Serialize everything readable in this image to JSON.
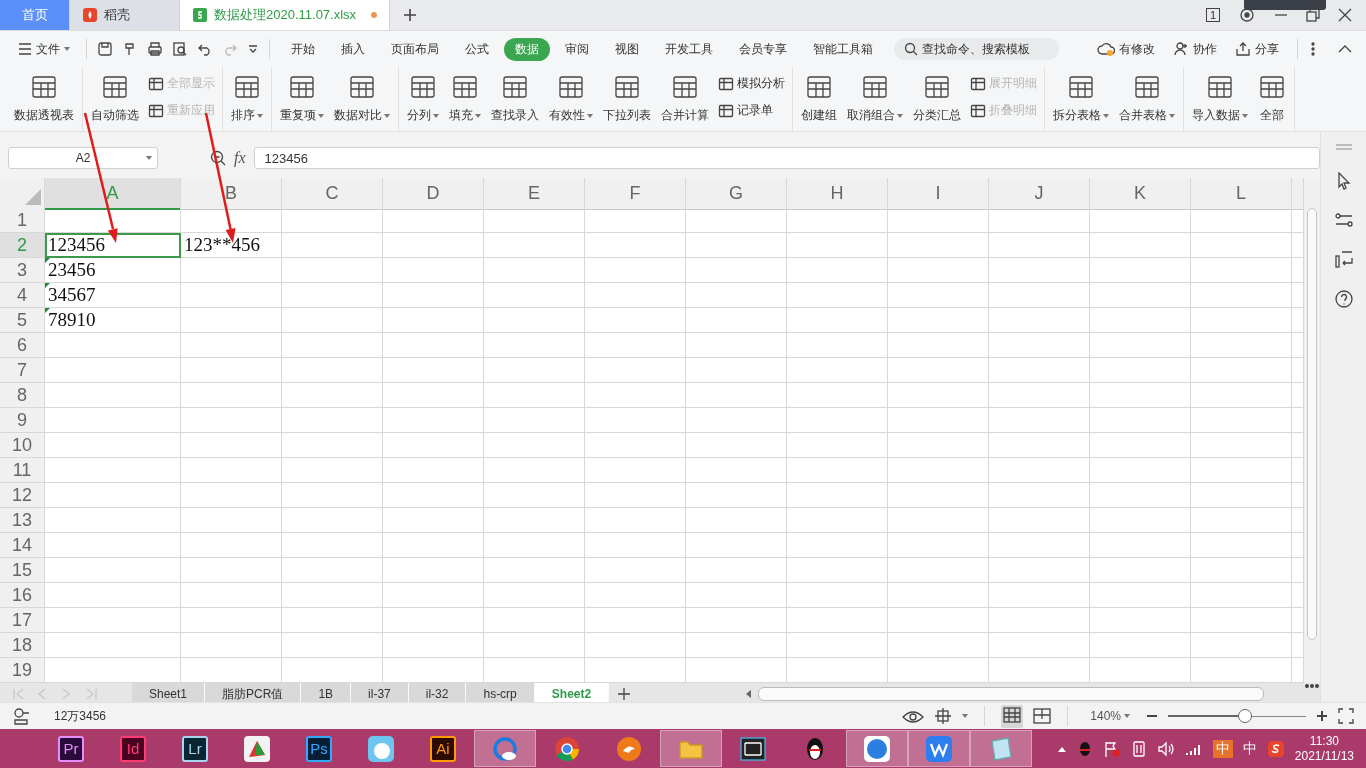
{
  "doc_tabs": [
    {
      "label": "首页",
      "kind": "home",
      "selected": false,
      "unsaved": false
    },
    {
      "label": "稻壳",
      "kind": "docer",
      "selected": false,
      "unsaved": false
    },
    {
      "label": "数据处理2020.11.07.xlsx",
      "kind": "sheet",
      "selected": true,
      "unsaved": true
    }
  ],
  "window_badge": "1",
  "menu": {
    "file": "文件",
    "tabs": [
      {
        "label": "开始",
        "selected": false
      },
      {
        "label": "插入",
        "selected": false
      },
      {
        "label": "页面布局",
        "selected": false
      },
      {
        "label": "公式",
        "selected": false
      },
      {
        "label": "数据",
        "selected": true
      },
      {
        "label": "审阅",
        "selected": false
      },
      {
        "label": "视图",
        "selected": false
      },
      {
        "label": "开发工具",
        "selected": false
      },
      {
        "label": "会员专享",
        "selected": false
      },
      {
        "label": "智能工具箱",
        "selected": false
      }
    ],
    "search": {
      "placeholder": "查找命令、搜索模板"
    },
    "actions": [
      {
        "label": "有修改",
        "kind": "cloud"
      },
      {
        "label": "协作",
        "kind": "user"
      },
      {
        "label": "分享",
        "kind": "share"
      }
    ]
  },
  "ribbon": {
    "groups": [
      {
        "items": [
          {
            "label": "数据透视表",
            "kind": "large",
            "dropdown": false,
            "disabled": false
          }
        ]
      },
      {
        "items": [
          {
            "label": "自动筛选",
            "kind": "large",
            "dropdown": false,
            "disabled": false
          },
          {
            "label": "全部显示",
            "kind": "small",
            "dropdown": false,
            "disabled": true
          },
          {
            "label": "重新应用",
            "kind": "small",
            "dropdown": false,
            "disabled": true
          }
        ]
      },
      {
        "items": [
          {
            "label": "排序",
            "kind": "large",
            "dropdown": true,
            "disabled": false
          }
        ]
      },
      {
        "items": [
          {
            "label": "重复项",
            "kind": "large",
            "dropdown": true,
            "disabled": false
          },
          {
            "label": "数据对比",
            "kind": "large",
            "dropdown": true,
            "disabled": false
          }
        ]
      },
      {
        "items": [
          {
            "label": "分列",
            "kind": "large",
            "dropdown": true,
            "disabled": false
          },
          {
            "label": "填充",
            "kind": "large",
            "dropdown": true,
            "disabled": false
          },
          {
            "label": "查找录入",
            "kind": "large",
            "dropdown": false,
            "disabled": false
          },
          {
            "label": "有效性",
            "kind": "large",
            "dropdown": true,
            "disabled": false
          },
          {
            "label": "下拉列表",
            "kind": "large",
            "dropdown": false,
            "disabled": false
          },
          {
            "label": "合并计算",
            "kind": "large",
            "dropdown": false,
            "disabled": false
          },
          {
            "label": "模拟分析",
            "kind": "small",
            "dropdown": false,
            "disabled": false
          },
          {
            "label": "记录单",
            "kind": "small",
            "dropdown": false,
            "disabled": false
          }
        ]
      },
      {
        "items": [
          {
            "label": "创建组",
            "kind": "large",
            "dropdown": false,
            "disabled": false
          },
          {
            "label": "取消组合",
            "kind": "large",
            "dropdown": true,
            "disabled": false
          },
          {
            "label": "分类汇总",
            "kind": "large",
            "dropdown": false,
            "disabled": false
          },
          {
            "label": "展开明细",
            "kind": "small",
            "dropdown": false,
            "disabled": true
          },
          {
            "label": "折叠明细",
            "kind": "small",
            "dropdown": false,
            "disabled": true
          }
        ]
      },
      {
        "items": [
          {
            "label": "拆分表格",
            "kind": "large",
            "dropdown": true,
            "disabled": false
          },
          {
            "label": "合并表格",
            "kind": "large",
            "dropdown": true,
            "disabled": false
          }
        ]
      },
      {
        "items": [
          {
            "label": "导入数据",
            "kind": "large",
            "dropdown": true,
            "disabled": false
          },
          {
            "label": "全部",
            "kind": "large",
            "dropdown": false,
            "disabled": false
          }
        ]
      }
    ]
  },
  "name_box": "A2",
  "fx": "fx",
  "formula": "123456",
  "columns": [
    {
      "label": "A",
      "selected": true
    },
    {
      "label": "B",
      "selected": false
    },
    {
      "label": "C",
      "selected": false
    },
    {
      "label": "D",
      "selected": false
    },
    {
      "label": "E",
      "selected": false
    },
    {
      "label": "F",
      "selected": false
    },
    {
      "label": "G",
      "selected": false
    },
    {
      "label": "H",
      "selected": false
    },
    {
      "label": "I",
      "selected": false
    },
    {
      "label": "J",
      "selected": false
    },
    {
      "label": "K",
      "selected": false
    },
    {
      "label": "L",
      "selected": false
    }
  ],
  "rows": [
    {
      "header": "1",
      "selected": false
    },
    {
      "header": "2",
      "selected": true,
      "column_a": "123456",
      "column_b": "123**456"
    },
    {
      "header": "3",
      "selected": false,
      "column_a": "23456",
      "text_flag": true
    },
    {
      "header": "4",
      "selected": false,
      "column_a": "34567",
      "text_flag": true
    },
    {
      "header": "5",
      "selected": false,
      "column_a": "78910",
      "text_flag": true
    },
    {
      "header": "6",
      "selected": false
    },
    {
      "header": "7",
      "selected": false
    },
    {
      "header": "8",
      "selected": false
    },
    {
      "header": "9",
      "selected": false
    },
    {
      "header": "10",
      "selected": false
    },
    {
      "header": "11",
      "selected": false
    },
    {
      "header": "12",
      "selected": false
    },
    {
      "header": "13",
      "selected": false
    },
    {
      "header": "14",
      "selected": false
    },
    {
      "header": "15",
      "selected": false
    },
    {
      "header": "16",
      "selected": false
    },
    {
      "header": "17",
      "selected": false
    },
    {
      "header": "18",
      "selected": false
    },
    {
      "header": "19",
      "selected": false
    }
  ],
  "sheet_tabs": [
    {
      "label": "Sheet1",
      "selected": false
    },
    {
      "label": "脂肪PCR值",
      "selected": false
    },
    {
      "label": "1B",
      "selected": false
    },
    {
      "label": "il-37",
      "selected": false
    },
    {
      "label": "il-32",
      "selected": false
    },
    {
      "label": "hs-crp",
      "selected": false
    },
    {
      "label": "Sheet2",
      "selected": true
    }
  ],
  "status_bar": {
    "value": "12万3456",
    "zoom": "140%",
    "zoom_slider": {
      "level": 0.55
    }
  },
  "taskbar": {
    "apps": [
      {
        "kind": "pr",
        "label": "Pr",
        "active": false
      },
      {
        "kind": "id",
        "label": "Id",
        "active": false
      },
      {
        "kind": "lr",
        "label": "Lr",
        "active": false
      },
      {
        "kind": "chart",
        "active": false
      },
      {
        "kind": "ps",
        "label": "Ps",
        "active": false
      },
      {
        "kind": "cat",
        "active": false
      },
      {
        "kind": "ai",
        "label": "Ai",
        "active": false
      },
      {
        "kind": "browser",
        "active": true
      },
      {
        "kind": "chrome",
        "active": false
      },
      {
        "kind": "fox",
        "active": false
      },
      {
        "kind": "folder",
        "active": true
      },
      {
        "kind": "film",
        "active": false
      },
      {
        "kind": "penguin",
        "active": false
      },
      {
        "kind": "globe",
        "active": true
      },
      {
        "kind": "wps",
        "active": true
      },
      {
        "kind": "notepad",
        "active": true
      }
    ],
    "ime": "中",
    "ime_mode": "中",
    "time": "11:30",
    "date": "2021/11/13"
  }
}
